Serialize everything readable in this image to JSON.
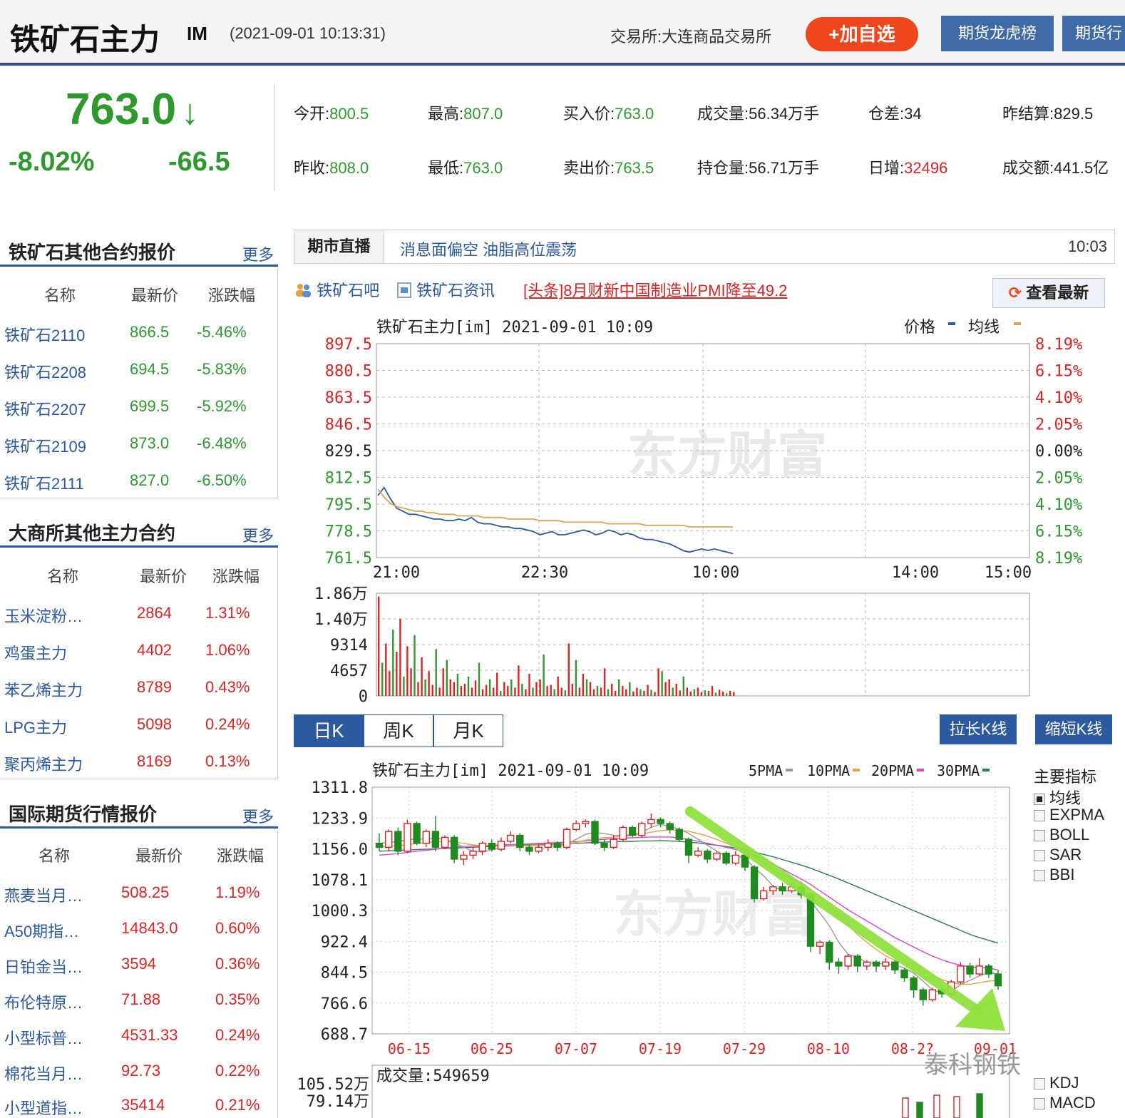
{
  "header": {
    "title": "铁矿石主力",
    "code": "IM",
    "datetime": "(2021-09-01 10:13:31)",
    "exchange": "交易所:大连商品交易所",
    "add_watch": "+加自选",
    "nav1": "期货龙虎榜",
    "nav2": "期货行"
  },
  "price": {
    "last": "763.0",
    "arrow": "↓",
    "pct": "-8.02%",
    "change": "-66.5"
  },
  "quotes": {
    "open_k": "今开:",
    "open_v": "800.5",
    "high_k": "最高:",
    "high_v": "807.0",
    "bid_k": "买入价:",
    "bid_v": "763.0",
    "vol_k": "成交量:",
    "vol_v": "56.34万手",
    "oi_diff_k": "仓差:",
    "oi_diff_v": "34",
    "prev_settle_k": "昨结算:",
    "prev_settle_v": "829.5",
    "prev_close_k": "昨收:",
    "prev_close_v": "808.0",
    "low_k": "最低:",
    "low_v": "763.0",
    "ask_k": "卖出价:",
    "ask_v": "763.5",
    "oi_k": "持仓量:",
    "oi_v": "56.71万手",
    "daily_inc_k": "日增:",
    "daily_inc_v": "32496",
    "amount_k": "成交额:",
    "amount_v": "441.5亿"
  },
  "panel1": {
    "title": "铁矿石其他合约报价",
    "more": "更多",
    "cols": [
      "名称",
      "最新价",
      "涨跌幅"
    ],
    "rows": [
      {
        "name": "铁矿石2110",
        "price": "866.5",
        "pct": "-5.46%"
      },
      {
        "name": "铁矿石2208",
        "price": "694.5",
        "pct": "-5.83%"
      },
      {
        "name": "铁矿石2207",
        "price": "699.5",
        "pct": "-5.92%"
      },
      {
        "name": "铁矿石2109",
        "price": "873.0",
        "pct": "-6.48%"
      },
      {
        "name": "铁矿石2111",
        "price": "827.0",
        "pct": "-6.50%"
      }
    ]
  },
  "panel2": {
    "title": "大商所其他主力合约",
    "more": "更多",
    "cols": [
      "名称",
      "最新价",
      "涨跌幅"
    ],
    "rows": [
      {
        "name": "玉米淀粉…",
        "price": "2864",
        "pct": "1.31%"
      },
      {
        "name": "鸡蛋主力",
        "price": "4402",
        "pct": "1.06%"
      },
      {
        "name": "苯乙烯主力",
        "price": "8789",
        "pct": "0.43%"
      },
      {
        "name": "LPG主力",
        "price": "5098",
        "pct": "0.24%"
      },
      {
        "name": "聚丙烯主力",
        "price": "8169",
        "pct": "0.13%"
      }
    ]
  },
  "panel3": {
    "title": "国际期货行情报价",
    "more": "更多",
    "cols": [
      "名称",
      "最新价",
      "涨跌幅"
    ],
    "rows": [
      {
        "name": "燕麦当月…",
        "price": "508.25",
        "pct": "1.19%"
      },
      {
        "name": "A50期指…",
        "price": "14843.0",
        "pct": "0.60%"
      },
      {
        "name": "日铂金当…",
        "price": "3594",
        "pct": "0.36%"
      },
      {
        "name": "布伦特原…",
        "price": "71.88",
        "pct": "0.35%"
      },
      {
        "name": "小型标普…",
        "price": "4531.33",
        "pct": "0.24%"
      },
      {
        "name": "棉花当月…",
        "price": "92.73",
        "pct": "0.22%"
      },
      {
        "name": "小型道指…",
        "price": "35414",
        "pct": "0.21%"
      }
    ]
  },
  "news": {
    "tag": "期市直播",
    "text": "消息面偏空 油脂高位震荡",
    "time": "10:03",
    "link1": "铁矿石吧",
    "link2": "铁矿石资讯",
    "headline": "[头条]8月财新中国制造业PMI降至49.2",
    "latest": "查看最新"
  },
  "kline_controls": {
    "tabs": [
      "日K",
      "周K",
      "月K"
    ],
    "longer": "拉长K线",
    "shorter": "缩短K线"
  },
  "indicators": {
    "title": "主要指标",
    "items": [
      "均线",
      "EXPMA",
      "BOLL",
      "SAR",
      "BBI"
    ],
    "bottom": [
      "KDJ",
      "MACD"
    ]
  },
  "watermark": "泰科钢铁",
  "colors": {
    "up": "#e02222",
    "down": "#2e9a2e",
    "accent": "#2b5aa0",
    "orange_btn": "#f0461e",
    "price_line": "#2b5aa0",
    "avg_line": "#d9a64e",
    "ma5": "#999999",
    "ma10": "#e8a33a",
    "ma20": "#e040e0",
    "ma30": "#2e7d4e"
  },
  "chart_data": [
    {
      "type": "line",
      "title": "铁矿石主力[im] 2021-09-01 10:09",
      "legend": [
        "价格",
        "均线"
      ],
      "y_left_ticks": [
        "897.5",
        "880.5",
        "863.5",
        "846.5",
        "829.5",
        "812.5",
        "795.5",
        "778.5",
        "761.5"
      ],
      "y_right_ticks": [
        "8.19%",
        "6.15%",
        "4.10%",
        "2.05%",
        "0.00%",
        "2.05%",
        "4.10%",
        "6.15%",
        "8.19%"
      ],
      "x_ticks": [
        "21:00",
        "22:30",
        "10:00",
        "14:00",
        "15:00"
      ],
      "ylim": [
        761.5,
        897.5
      ],
      "series": [
        {
          "name": "价格",
          "values": [
            801,
            806,
            799,
            793,
            791,
            789,
            789,
            788,
            787,
            786,
            786,
            785,
            785,
            786,
            785,
            787,
            784,
            783,
            783,
            782,
            781,
            781,
            780,
            780,
            779,
            778,
            776,
            777,
            778,
            776,
            776,
            777,
            778,
            779,
            778,
            776,
            777,
            779,
            778,
            776,
            777,
            776,
            774,
            773,
            773,
            772,
            771,
            770,
            768,
            766,
            765,
            766,
            767,
            766,
            767,
            766,
            765,
            764
          ]
        },
        {
          "name": "均线",
          "values": [
            805,
            800,
            796,
            794,
            793,
            792,
            791,
            791,
            790,
            790,
            789,
            789,
            789,
            788,
            788,
            788,
            788,
            787,
            787,
            787,
            787,
            786,
            786,
            786,
            786,
            786,
            785,
            785,
            785,
            785,
            784,
            784,
            784,
            784,
            784,
            784,
            784,
            783,
            783,
            783,
            783,
            783,
            783,
            782,
            782,
            782,
            782,
            782,
            782,
            782,
            781,
            781,
            781,
            781,
            781,
            781,
            781,
            781
          ]
        }
      ]
    },
    {
      "type": "bar",
      "title": "",
      "y_ticks": [
        "1.86万",
        "1.40万",
        "9314",
        "4657",
        "0"
      ],
      "ylim": [
        0,
        18600
      ],
      "values": [
        18000,
        6000,
        9500,
        4500,
        12000,
        8000,
        14000,
        3500,
        9000,
        5000,
        11000,
        2500,
        7000,
        3000,
        4500,
        2000,
        8500,
        1500,
        5000,
        6500,
        3000,
        2500,
        4000,
        1800,
        2200,
        3500,
        1500,
        2800,
        6000,
        1200,
        2000,
        3000,
        1500,
        4200,
        900,
        2500,
        1800,
        3000,
        1500,
        5500,
        2200,
        1200,
        4000,
        1500,
        2500,
        3000,
        7500,
        1800,
        2000,
        1200,
        3500,
        1500,
        1000,
        9500,
        2200,
        6500,
        1500,
        4000,
        3000,
        2500,
        1200,
        1800,
        1500,
        5000,
        1200,
        2200,
        900,
        3000,
        1800,
        1200,
        2500,
        800,
        1500,
        1200,
        900,
        2000,
        1100,
        700,
        5000,
        4500,
        2500,
        3000,
        1500,
        2200,
        1000,
        3500,
        1500,
        800,
        1200,
        1500,
        700,
        1000,
        900,
        1800,
        600,
        1100,
        800,
        500,
        900,
        700
      ]
    },
    {
      "type": "candlestick",
      "title": "铁矿石主力[im] 2021-09-01 10:09",
      "legend": [
        "5PMA",
        "10PMA",
        "20PMA",
        "30PMA"
      ],
      "y_ticks": [
        "1311.8",
        "1233.9",
        "1156.0",
        "1078.1",
        "1000.3",
        "922.4",
        "844.5",
        "766.6",
        "688.7"
      ],
      "x_ticks": [
        "06-15",
        "06-25",
        "07-07",
        "07-19",
        "07-29",
        "08-10",
        "08-2?",
        "09-01"
      ],
      "ylim": [
        688.7,
        1311.8
      ],
      "candles": [
        [
          1170,
          1160,
          1195,
          1150
        ],
        [
          1160,
          1200,
          1205,
          1150
        ],
        [
          1200,
          1150,
          1210,
          1140
        ],
        [
          1150,
          1220,
          1230,
          1145
        ],
        [
          1220,
          1170,
          1225,
          1165
        ],
        [
          1170,
          1200,
          1205,
          1160
        ],
        [
          1200,
          1160,
          1240,
          1150
        ],
        [
          1160,
          1185,
          1190,
          1155
        ],
        [
          1185,
          1130,
          1190,
          1120
        ],
        [
          1130,
          1140,
          1150,
          1115
        ],
        [
          1140,
          1150,
          1160,
          1130
        ],
        [
          1150,
          1170,
          1175,
          1140
        ],
        [
          1170,
          1155,
          1180,
          1150
        ],
        [
          1155,
          1175,
          1185,
          1150
        ],
        [
          1175,
          1190,
          1200,
          1170
        ],
        [
          1190,
          1160,
          1195,
          1150
        ],
        [
          1160,
          1150,
          1165,
          1140
        ],
        [
          1150,
          1160,
          1170,
          1145
        ],
        [
          1160,
          1170,
          1180,
          1150
        ],
        [
          1170,
          1160,
          1175,
          1150
        ],
        [
          1160,
          1205,
          1210,
          1155
        ],
        [
          1205,
          1220,
          1228,
          1200
        ],
        [
          1220,
          1225,
          1230,
          1210
        ],
        [
          1225,
          1170,
          1230,
          1165
        ],
        [
          1170,
          1160,
          1180,
          1150
        ],
        [
          1160,
          1180,
          1190,
          1155
        ],
        [
          1180,
          1210,
          1215,
          1175
        ],
        [
          1210,
          1190,
          1215,
          1185
        ],
        [
          1190,
          1220,
          1225,
          1185
        ],
        [
          1220,
          1230,
          1245,
          1210
        ],
        [
          1230,
          1220,
          1235,
          1210
        ],
        [
          1220,
          1205,
          1225,
          1195
        ],
        [
          1205,
          1180,
          1210,
          1175
        ],
        [
          1180,
          1140,
          1185,
          1120
        ],
        [
          1140,
          1150,
          1160,
          1135
        ],
        [
          1150,
          1130,
          1155,
          1120
        ],
        [
          1130,
          1145,
          1150,
          1125
        ],
        [
          1145,
          1120,
          1150,
          1115
        ],
        [
          1120,
          1140,
          1150,
          1115
        ],
        [
          1140,
          1110,
          1145,
          1100
        ],
        [
          1110,
          1030,
          1115,
          1020
        ],
        [
          1030,
          1050,
          1060,
          1025
        ],
        [
          1050,
          1060,
          1065,
          1040
        ],
        [
          1060,
          1050,
          1070,
          1040
        ],
        [
          1050,
          1060,
          1070,
          1045
        ],
        [
          1060,
          1040,
          1070,
          1030
        ],
        [
          1040,
          910,
          1045,
          895
        ],
        [
          910,
          920,
          925,
          890
        ],
        [
          920,
          870,
          925,
          850
        ],
        [
          870,
          860,
          880,
          840
        ],
        [
          860,
          885,
          890,
          850
        ],
        [
          885,
          860,
          890,
          845
        ],
        [
          860,
          870,
          875,
          850
        ],
        [
          870,
          860,
          875,
          845
        ],
        [
          860,
          870,
          880,
          850
        ],
        [
          870,
          850,
          875,
          840
        ],
        [
          850,
          830,
          855,
          820
        ],
        [
          830,
          800,
          835,
          780
        ],
        [
          800,
          775,
          805,
          760
        ],
        [
          775,
          800,
          805,
          770
        ],
        [
          800,
          790,
          810,
          780
        ],
        [
          790,
          820,
          825,
          785
        ],
        [
          820,
          860,
          870,
          815
        ],
        [
          860,
          840,
          868,
          830
        ],
        [
          840,
          860,
          880,
          835
        ],
        [
          860,
          840,
          865,
          830
        ],
        [
          840,
          810,
          850,
          800
        ]
      ],
      "ma5": [
        1170,
        1172,
        1175,
        1178,
        1182,
        1180,
        1183,
        1180,
        1172,
        1160,
        1150,
        1148,
        1153,
        1160,
        1165,
        1168,
        1168,
        1167,
        1163,
        1160,
        1168,
        1180,
        1193,
        1197,
        1195,
        1190,
        1190,
        1192,
        1198,
        1210,
        1218,
        1212,
        1206,
        1195,
        1180,
        1165,
        1150,
        1138,
        1138,
        1133,
        1108,
        1088,
        1062,
        1050,
        1050,
        1052,
        1024,
        994,
        962,
        920,
        890,
        882,
        868,
        866,
        866,
        862,
        855,
        842,
        822,
        800,
        792,
        796,
        813,
        824,
        835,
        843,
        840
      ],
      "ma10": [
        1160,
        1162,
        1164,
        1166,
        1170,
        1172,
        1174,
        1175,
        1173,
        1170,
        1166,
        1164,
        1163,
        1162,
        1163,
        1164,
        1164,
        1165,
        1166,
        1166,
        1168,
        1172,
        1178,
        1182,
        1184,
        1186,
        1188,
        1190,
        1194,
        1198,
        1202,
        1204,
        1203,
        1200,
        1195,
        1188,
        1180,
        1170,
        1162,
        1154,
        1138,
        1120,
        1102,
        1090,
        1080,
        1072,
        1054,
        1036,
        1012,
        988,
        964,
        940,
        920,
        902,
        886,
        874,
        866,
        858,
        848,
        836,
        826,
        818,
        814,
        814,
        818,
        822,
        824
      ],
      "ma20": [
        1140,
        1142,
        1144,
        1147,
        1150,
        1152,
        1155,
        1158,
        1160,
        1162,
        1163,
        1164,
        1165,
        1166,
        1167,
        1168,
        1169,
        1170,
        1171,
        1172,
        1173,
        1174,
        1176,
        1178,
        1180,
        1182,
        1183,
        1184,
        1185,
        1186,
        1186,
        1186,
        1184,
        1180,
        1175,
        1170,
        1165,
        1160,
        1154,
        1148,
        1140,
        1130,
        1118,
        1105,
        1092,
        1080,
        1066,
        1050,
        1034,
        1018,
        1002,
        988,
        974,
        960,
        946,
        932,
        920,
        908,
        896,
        885,
        876,
        868,
        862,
        858,
        856,
        855,
        850
      ],
      "ma30": [
        1150,
        1151,
        1152,
        1153,
        1154,
        1155,
        1156,
        1157,
        1158,
        1159,
        1160,
        1161,
        1162,
        1163,
        1164,
        1165,
        1166,
        1167,
        1168,
        1168,
        1169,
        1170,
        1171,
        1172,
        1173,
        1174,
        1175,
        1175,
        1176,
        1176,
        1177,
        1176,
        1175,
        1173,
        1171,
        1168,
        1165,
        1162,
        1158,
        1154,
        1148,
        1142,
        1136,
        1129,
        1122,
        1115,
        1107,
        1098,
        1089,
        1080,
        1070,
        1060,
        1050,
        1040,
        1030,
        1020,
        1010,
        1000,
        990,
        980,
        970,
        960,
        950,
        940,
        932,
        925,
        918
      ]
    },
    {
      "type": "bar",
      "title": "成交量:549659",
      "y_ticks": [
        "105.52万",
        "79.14万"
      ],
      "values": []
    }
  ]
}
